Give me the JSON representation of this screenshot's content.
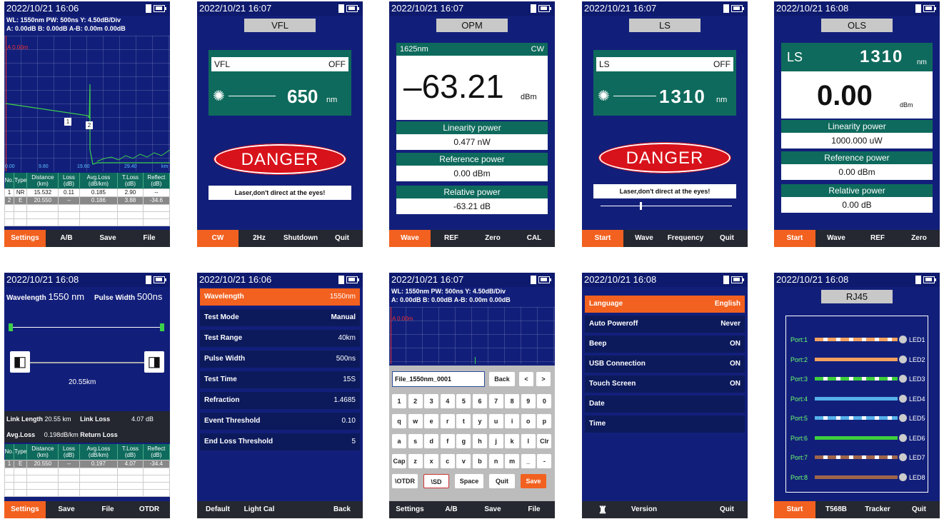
{
  "s1": {
    "time": "2022/10/21 16:06",
    "info1": "WL: 1550nm  PW: 500ns  Y: 4.50dB/Div",
    "info2": "A: 0.00dB B: 0.00dB A-B: 0.00m 0.00dB",
    "cursor": "A 0.00m",
    "xt": [
      "0.00",
      "9.80",
      "19.60",
      "29.40",
      "km"
    ],
    "m1": "1",
    "m2": "2",
    "cols": [
      "No.",
      "Type",
      "Distance (km)",
      "Loss (dB)",
      "Avg.Loss (dB/km)",
      "T.Loss (dB)",
      "Reflect (dB)"
    ],
    "rows": [
      [
        "1",
        "NR",
        "15.532",
        "0.11",
        "0.185",
        "2.90",
        "--"
      ],
      [
        "2",
        "E",
        "20.550",
        "--",
        "0.186",
        "3.88",
        "-34.6"
      ]
    ],
    "btns": [
      "Settings",
      "A/B",
      "Save",
      "File"
    ]
  },
  "s2": {
    "time": "2022/10/21 16:07",
    "title": "VFL",
    "label": "VFL",
    "state": "OFF",
    "wave": "650",
    "unit": "nm",
    "danger": "DANGER",
    "warn": "Laser,don't direct at the eyes!",
    "btns": [
      "CW",
      "2Hz",
      "Shutdown",
      "Quit"
    ]
  },
  "s3": {
    "time": "2022/10/21 16:07",
    "title": "OPM",
    "wave": "1625nm",
    "mode": "CW",
    "value": "–63.21",
    "unit": "dBm",
    "l1": "Linearity power",
    "v1": "0.477 nW",
    "l2": "Reference power",
    "v2": "0.00 dBm",
    "l3": "Relative power",
    "v3": "-63.21 dB",
    "btns": [
      "Wave",
      "REF",
      "Zero",
      "CAL"
    ]
  },
  "s4": {
    "time": "2022/10/21 16:07",
    "title": "LS",
    "label": "LS",
    "state": "OFF",
    "wave": "1310",
    "unit": "nm",
    "danger": "DANGER",
    "warn": "Laser,don't direct at the eyes!",
    "slider": 0.3,
    "btns": [
      "Start",
      "Wave",
      "Frequency",
      "Quit"
    ]
  },
  "s5": {
    "time": "2022/10/21 16:08",
    "title": "OLS",
    "label": "LS",
    "wave": "1310",
    "wunit": "nm",
    "value": "0.00",
    "unit": "dBm",
    "l1": "Linearity power",
    "v1": "1000.000 uW",
    "l2": "Reference power",
    "v2": "0.00 dBm",
    "l3": "Relative power",
    "v3": "0.00 dB",
    "btns": [
      "Start",
      "Wave",
      "REF",
      "Zero"
    ]
  },
  "s6": {
    "time": "2022/10/21 16:08",
    "wl_l": "Wavelength",
    "wl_v": "1550 nm",
    "pw_l": "Pulse Width",
    "pw_v": "500ns",
    "dist": "20.55km",
    "ll_l": "Link Length",
    "ll_v": "20.55 km",
    "lk_l": "Link Loss",
    "lk_v": "4.07 dB",
    "al_l": "Avg.Loss",
    "al_v": "0.198dB/km",
    "rl_l": "Return Loss",
    "cols": [
      "No.",
      "Type",
      "Distance (km)",
      "Loss (dB)",
      "Avg.Loss (dB/km)",
      "T.Loss (dB)",
      "Reflect (dB)"
    ],
    "rows": [
      [
        "1",
        "E",
        "20.550",
        "--",
        "0.197",
        "4.07",
        "-34.4"
      ]
    ],
    "btns": [
      "Settings",
      "Save",
      "File",
      "OTDR"
    ]
  },
  "s7": {
    "time": "2022/10/21 16:06",
    "items": [
      [
        "Wavelength",
        "1550nm"
      ],
      [
        "Test Mode",
        "Manual"
      ],
      [
        "Test Range",
        "40km"
      ],
      [
        "Pulse Width",
        "500ns"
      ],
      [
        "Test Time",
        "15S"
      ],
      [
        "Refraction",
        "1.4685"
      ],
      [
        "Event Threshold",
        "0.10"
      ],
      [
        "End Loss Threshold",
        "5"
      ]
    ],
    "btns": [
      "Default",
      "Light Cal",
      "",
      "Back"
    ]
  },
  "s8": {
    "time": "2022/10/21 16:07",
    "info1": "WL: 1550nm  PW: 500ns  Y: 4.50dB/Div",
    "info2": "A: 0.00dB B: 0.00dB A-B: 0.00m 0.00dB",
    "cursor": "A 0.00m",
    "filename": "File_1550nm_0001",
    "back": "Back",
    "lt": "<",
    "gt": ">",
    "r1": [
      "1",
      "2",
      "3",
      "4",
      "5",
      "6",
      "7",
      "8",
      "9",
      "0"
    ],
    "r2": [
      "q",
      "w",
      "e",
      "r",
      "t",
      "y",
      "u",
      "i",
      "o",
      "p"
    ],
    "r3": [
      "a",
      "s",
      "d",
      "f",
      "g",
      "h",
      "j",
      "k",
      "l",
      "Clr"
    ],
    "r4": [
      "Cap",
      "z",
      "x",
      "c",
      "v",
      "b",
      "n",
      "m",
      "_",
      "-"
    ],
    "r5": [
      "\\OTDR",
      "\\SD",
      "Space",
      "Quit",
      "Save"
    ],
    "btns": [
      "Settings",
      "A/B",
      "Save",
      "File"
    ]
  },
  "s9": {
    "time": "2022/10/21 16:08",
    "items": [
      [
        "Language",
        "English"
      ],
      [
        "Auto Poweroff",
        "Never"
      ],
      [
        "Beep",
        "ON"
      ],
      [
        "USB Connection",
        "ON"
      ],
      [
        "Touch Screen",
        "ON"
      ],
      [
        "Date",
        ""
      ],
      [
        "Time",
        ""
      ]
    ],
    "btns": [
      "",
      "Version",
      "",
      "Quit"
    ]
  },
  "s10": {
    "time": "2022/10/21 16:08",
    "title": "RJ45",
    "ports": [
      {
        "p": "Port:1",
        "l": "LED1",
        "c": "#f2a15f",
        "s": true
      },
      {
        "p": "Port:2",
        "l": "LED2",
        "c": "#f2a15f",
        "s": false
      },
      {
        "p": "Port:3",
        "l": "LED3",
        "c": "#3dcf3d",
        "s": true
      },
      {
        "p": "Port:4",
        "l": "LED4",
        "c": "#55b0ea",
        "s": false
      },
      {
        "p": "Port:5",
        "l": "LED5",
        "c": "#55b0ea",
        "s": true
      },
      {
        "p": "Port:6",
        "l": "LED6",
        "c": "#3dcf3d",
        "s": false
      },
      {
        "p": "Port:7",
        "l": "LED7",
        "c": "#a0664a",
        "s": true
      },
      {
        "p": "Port:8",
        "l": "LED8",
        "c": "#a0664a",
        "s": false
      }
    ],
    "btns": [
      "Start",
      "T568B",
      "Tracker",
      "Quit"
    ]
  }
}
